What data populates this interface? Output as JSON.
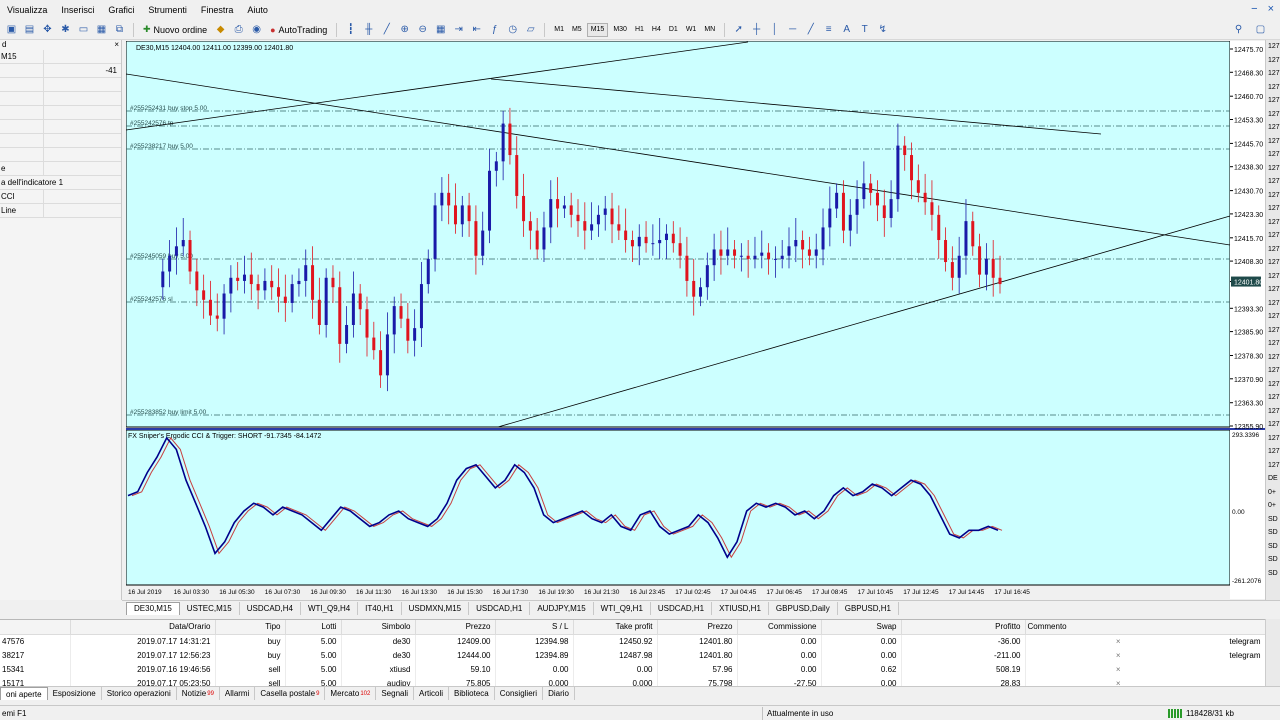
{
  "menu": [
    "Visualizza",
    "Inserisci",
    "Grafici",
    "Strumenti",
    "Finestra",
    "Aiuto"
  ],
  "toolbar": {
    "new_order": "Nuovo ordine",
    "autotrading": "AutoTrading",
    "timeframes": [
      "M1",
      "M5",
      "M15",
      "M30",
      "H1",
      "H4",
      "D1",
      "W1",
      "MN"
    ],
    "active_timeframe": "M15"
  },
  "left_panel": {
    "header": "d",
    "rows": [
      {
        "name": "M15",
        "value": ""
      },
      {
        "name": "",
        "value": "-41"
      },
      {
        "name": "",
        "value": ""
      },
      {
        "name": "",
        "value": ""
      },
      {
        "name": "",
        "value": ""
      },
      {
        "name": "",
        "value": ""
      },
      {
        "name": "",
        "value": ""
      },
      {
        "name": "",
        "value": ""
      },
      {
        "name": "e",
        "value": ""
      },
      {
        "name": "a dell'indicatore 1",
        "value": ""
      },
      {
        "name": "CCI",
        "value": ""
      },
      {
        "name": "Line",
        "value": ""
      }
    ]
  },
  "chart": {
    "symbol_header": "DE30,M15  12404.00 12411.00 12399.00 12401.80",
    "current_price": "12401.80",
    "price_ticks": [
      "12475.70",
      "12468.30",
      "12460.70",
      "12453.30",
      "12445.70",
      "12438.30",
      "12430.70",
      "12423.30",
      "12415.70",
      "12408.30",
      "12401.80",
      "12393.30",
      "12385.90",
      "12378.30",
      "12370.90",
      "12363.30",
      "12355.90"
    ],
    "order_labels": [
      "#255252431 buy stop 5.00",
      "#255242576 tp",
      "#255238217 buy 5.00",
      "#255245059 buy 5.00",
      "#255242576 sl",
      "#255283852 buy limit 5.00"
    ],
    "indicator_label": "FX Sniper's Ergodic CCI & Trigger: SHORT -91.7345 -84.1472",
    "indicator_ticks": [
      "293.3396",
      "0.00",
      "-261.2076"
    ],
    "time_ticks": [
      "16 Jul 2019",
      "16 Jul 03:30",
      "16 Jul 05:30",
      "16 Jul 07:30",
      "16 Jul 09:30",
      "16 Jul 11:30",
      "16 Jul 13:30",
      "16 Jul 15:30",
      "16 Jul 17:30",
      "16 Jul 19:30",
      "16 Jul 21:30",
      "16 Jul 23:45",
      "17 Jul 02:45",
      "17 Jul 04:45",
      "17 Jul 06:45",
      "17 Jul 08:45",
      "17 Jul 10:45",
      "17 Jul 12:45",
      "17 Jul 14:45",
      "17 Jul 16:45"
    ],
    "colors": {
      "bg": "#ccffff",
      "bull": "#1a1aa8",
      "bear": "#e0141e",
      "cci": "#00008b",
      "trigger": "#c84040"
    }
  },
  "chart_tabs": [
    "DE30,M15",
    "USTEC,M15",
    "USDCAD,H4",
    "WTI_Q9,H4",
    "IT40,H1",
    "USDMXN,M15",
    "USDCAD,H1",
    "AUDJPY,M15",
    "WTI_Q9,H1",
    "USDCAD,H1",
    "XTIUSD,H1",
    "GBPUSD,Daily",
    "GBPUSD,H1"
  ],
  "terminal": {
    "columns": [
      "",
      "Data/Orario",
      "Tipo",
      "Lotti",
      "Simbolo",
      "Prezzo",
      "S / L",
      "Take profit",
      "Prezzo",
      "Commissione",
      "Swap",
      "Profitto",
      "Commento"
    ],
    "rows": [
      [
        "47576",
        "2019.07.17 14:31:21",
        "buy",
        "5.00",
        "de30",
        "12409.00",
        "12394.98",
        "12450.92",
        "12401.80",
        "0.00",
        "0.00",
        "-36.00",
        "telegram"
      ],
      [
        "38217",
        "2019.07.17 12:56:23",
        "buy",
        "5.00",
        "de30",
        "12444.00",
        "12394.89",
        "12487.98",
        "12401.80",
        "0.00",
        "0.00",
        "-211.00",
        "telegram"
      ],
      [
        "15341",
        "2019.07.16 19:46:56",
        "sell",
        "5.00",
        "xtiusd",
        "59.10",
        "0.00",
        "0.00",
        "57.96",
        "0.00",
        "0.62",
        "508.19",
        ""
      ],
      [
        "15171",
        "2019.07.17 05:23:50",
        "sell",
        "5.00",
        "audjpy",
        "75.805",
        "0.000",
        "0.000",
        "75.798",
        "-27.50",
        "0.00",
        "28.83",
        ""
      ]
    ]
  },
  "terminal_tabs": [
    {
      "label": "oni aperte",
      "badge": ""
    },
    {
      "label": "Esposizione",
      "badge": ""
    },
    {
      "label": "Storico operazioni",
      "badge": ""
    },
    {
      "label": "Notizie",
      "badge": "99"
    },
    {
      "label": "Allarmi",
      "badge": ""
    },
    {
      "label": "Casella postale",
      "badge": "9"
    },
    {
      "label": "Mercato",
      "badge": "102"
    },
    {
      "label": "Segnali",
      "badge": ""
    },
    {
      "label": "Articoli",
      "badge": ""
    },
    {
      "label": "Biblioteca",
      "badge": ""
    },
    {
      "label": "Consiglieri",
      "badge": ""
    },
    {
      "label": "Diario",
      "badge": ""
    }
  ],
  "status": {
    "help": "emi F1",
    "profile": "Attualmente in uso",
    "traffic": "118428/31 kb"
  },
  "right_strip": [
    "127",
    "127",
    "127",
    "127",
    "127",
    "127",
    "127",
    "127",
    "127",
    "127",
    "127",
    "127",
    "127",
    "127",
    "127",
    "127",
    "127",
    "127",
    "127",
    "127",
    "127",
    "127",
    "127",
    "127",
    "127",
    "127",
    "127",
    "127",
    "127",
    "127",
    "127",
    "127",
    "DE",
    "0+",
    "0+",
    "SD",
    "SD",
    "SD",
    "SD",
    "SD"
  ]
}
